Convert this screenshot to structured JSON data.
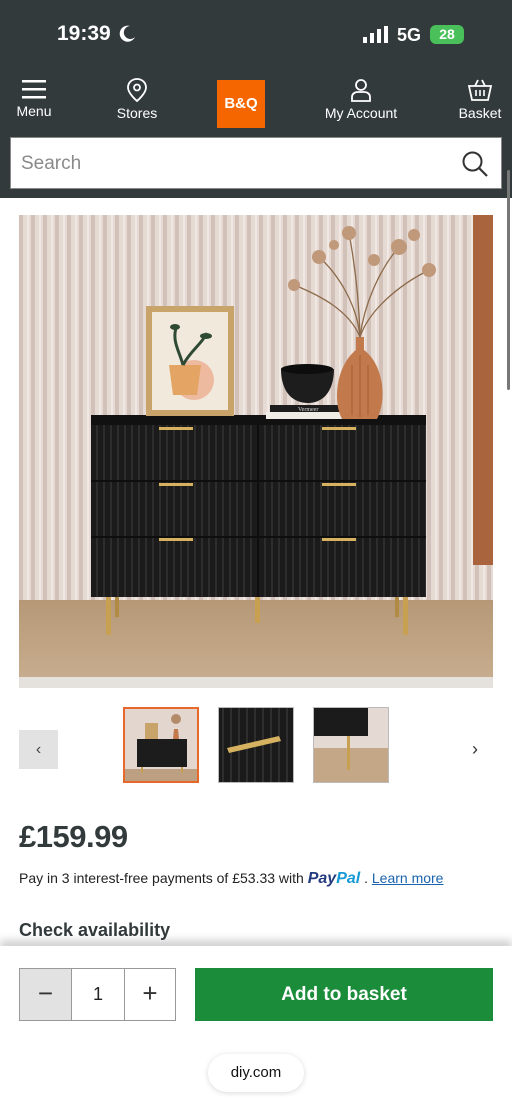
{
  "status_bar": {
    "time": "19:39",
    "network": "5G",
    "battery": "28"
  },
  "header": {
    "nav": [
      {
        "label": "Menu"
      },
      {
        "label": "Stores"
      },
      {
        "label": "My Account"
      },
      {
        "label": "Basket"
      }
    ],
    "logo_text": "B&Q"
  },
  "search": {
    "placeholder": "Search"
  },
  "product": {
    "price": "£159.99",
    "paypal": {
      "prefix": "Pay in 3 interest-free payments of £53.33 with",
      "brand_part1": "Pay",
      "brand_part2": "Pal",
      "learn_more": "Learn more"
    },
    "check_availability": "Check availability",
    "gallery": {
      "prev_icon": "‹",
      "next_icon": "›"
    },
    "vase_book_text": "Vermeer"
  },
  "purchase": {
    "minus": "−",
    "quantity": "1",
    "plus": "+",
    "add_label": "Add to basket"
  },
  "browser": {
    "domain": "diy.com"
  },
  "colors": {
    "header_bg": "#333a3c",
    "brand_orange": "#f56600",
    "cta_green": "#1b8d3a",
    "paypal_dark": "#253b80",
    "paypal_light": "#179bd7"
  }
}
